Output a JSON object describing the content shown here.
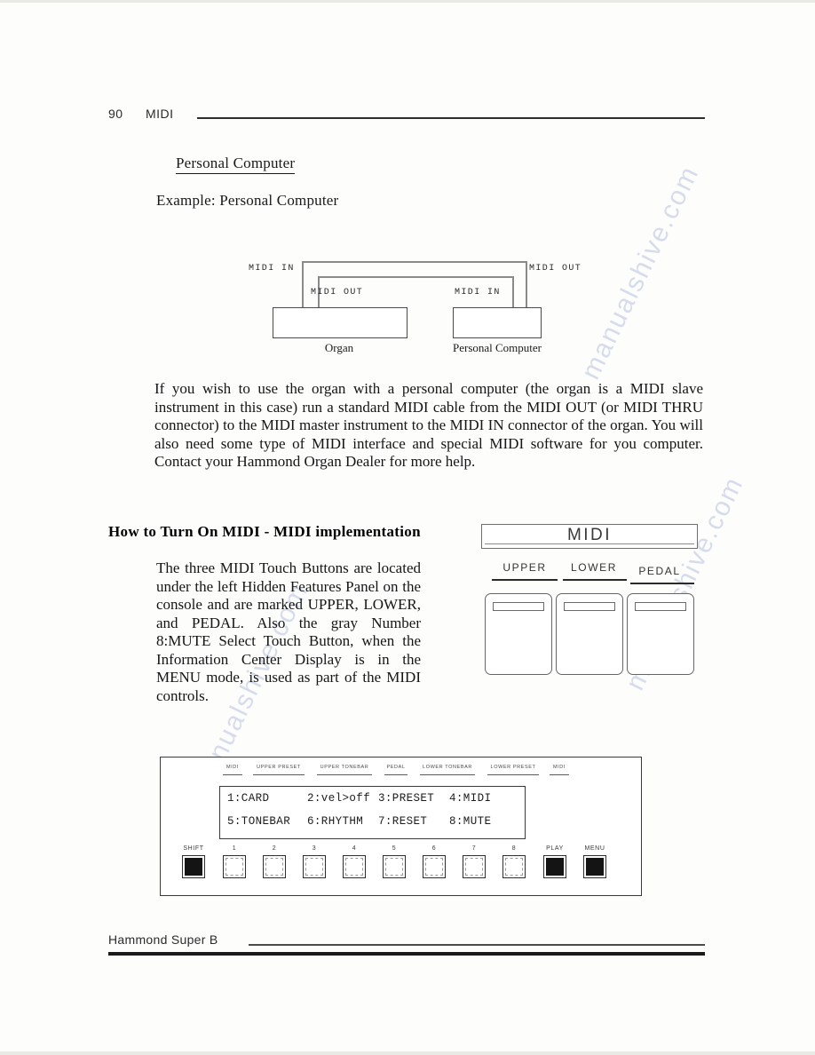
{
  "header": {
    "page_number": "90",
    "section": "MIDI"
  },
  "content": {
    "subhead": "Personal Computer",
    "example_line": "Example: Personal Computer",
    "main_paragraph": "If you wish to use the organ with a personal computer (the organ is a MIDI slave instrument in this case)  run a standard MIDI cable from the MIDI OUT (or MIDI THRU connector) to the MIDI master instrument to the MIDI IN connector of the organ.  You will also need some type of MIDI interface and special MIDI software for you computer.   Contact your Hammond Organ Dealer for more help.",
    "section_head": "How to Turn On MIDI - MIDI implementation",
    "left_paragraph": "The three MIDI Touch Buttons are located under the left Hidden Features Panel on the console and are marked UPPER, LOWER, and PEDAL.  Also the gray Number 8:MUTE Select Touch Button, when the Information Center Display is in the MENU mode, is used as part of the MIDI controls."
  },
  "diagram": {
    "labels": {
      "organ_midi_in": "MIDI IN",
      "organ_midi_out": "MIDI OUT",
      "computer_midi_out": "MIDI  OUT",
      "computer_midi_in": "MIDI IN"
    },
    "captions": {
      "left": "Organ",
      "right": "Personal Computer"
    }
  },
  "midi_panel": {
    "title": "MIDI",
    "segments": [
      "UPPER",
      "LOWER",
      "PEDAL"
    ]
  },
  "console": {
    "ticks": [
      "MIDI",
      "UPPER PRESET",
      "UPPER TONEBAR",
      "PEDAL",
      "LOWER TONEBAR",
      "LOWER PRESET",
      "MIDI"
    ],
    "display": {
      "row1": [
        "1:CARD",
        "2:vel>off",
        "3:PRESET",
        "4:MIDI"
      ],
      "row2": [
        "5:TONEBAR",
        "6:RHYTHM",
        "7:RESET",
        "8:MUTE"
      ]
    },
    "buttons": [
      {
        "label": "SHIFT",
        "dark": true
      },
      {
        "label": "1",
        "dark": false
      },
      {
        "label": "2",
        "dark": false
      },
      {
        "label": "3",
        "dark": false
      },
      {
        "label": "4",
        "dark": false
      },
      {
        "label": "5",
        "dark": false
      },
      {
        "label": "6",
        "dark": false
      },
      {
        "label": "7",
        "dark": false
      },
      {
        "label": "8",
        "dark": false
      },
      {
        "label": "PLAY",
        "dark": true
      },
      {
        "label": "MENU",
        "dark": true
      }
    ]
  },
  "footer": {
    "brand": "Hammond Super B"
  },
  "watermark": {
    "text": "manualshive.com"
  }
}
